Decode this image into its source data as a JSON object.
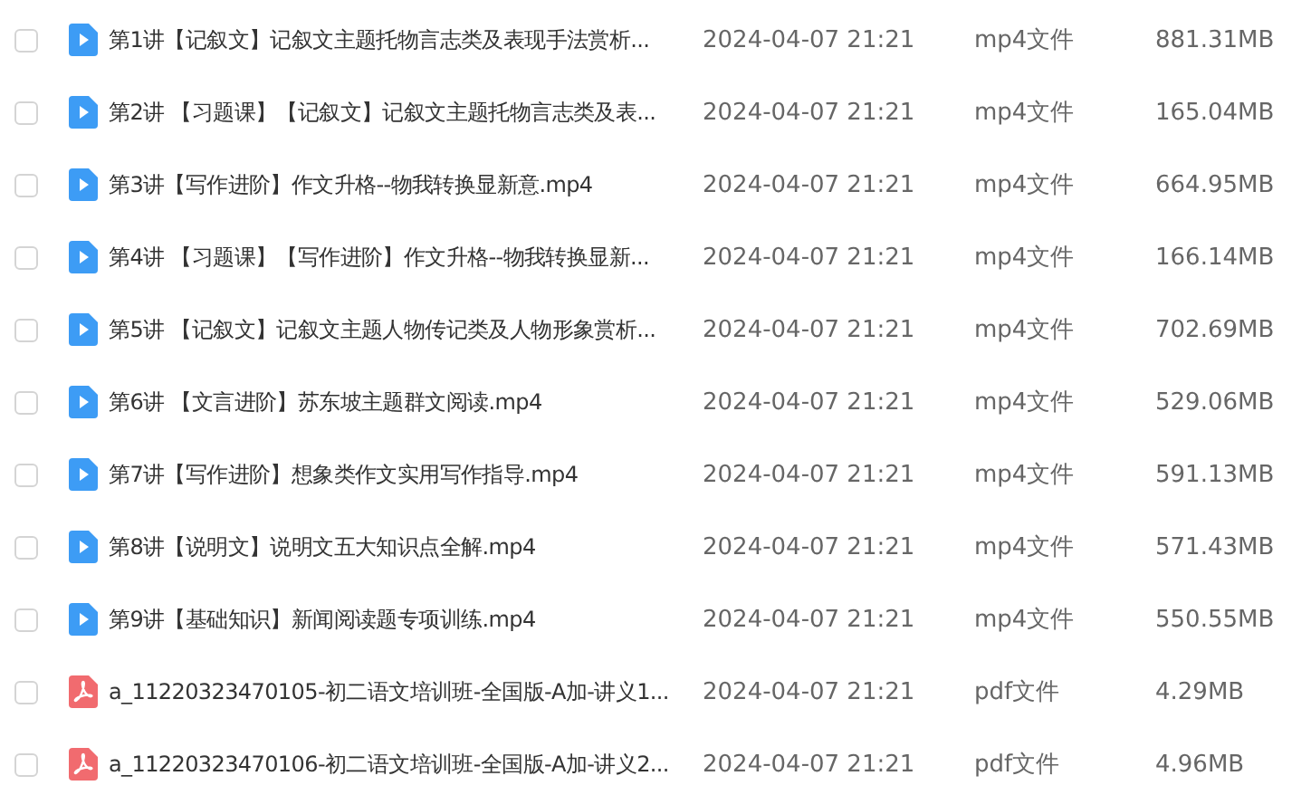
{
  "files": [
    {
      "kind": "video",
      "checked": false,
      "name": "第1讲【记叙文】记叙文主题托物言志类及表现手法赏析...",
      "modified": "2024-04-07 21:21",
      "type": "mp4文件",
      "size": "881.31MB"
    },
    {
      "kind": "video",
      "checked": false,
      "name": "第2讲 【习题课】【记叙文】记叙文主题托物言志类及表...",
      "modified": "2024-04-07 21:21",
      "type": "mp4文件",
      "size": "165.04MB"
    },
    {
      "kind": "video",
      "checked": false,
      "name": "第3讲【写作进阶】作文升格--物我转换显新意.mp4",
      "modified": "2024-04-07 21:21",
      "type": "mp4文件",
      "size": "664.95MB"
    },
    {
      "kind": "video",
      "checked": false,
      "name": "第4讲 【习题课】【写作进阶】作文升格--物我转换显新...",
      "modified": "2024-04-07 21:21",
      "type": "mp4文件",
      "size": "166.14MB"
    },
    {
      "kind": "video",
      "checked": false,
      "name": "第5讲 【记叙文】记叙文主题人物传记类及人物形象赏析...",
      "modified": "2024-04-07 21:21",
      "type": "mp4文件",
      "size": "702.69MB"
    },
    {
      "kind": "video",
      "checked": false,
      "name": "第6讲 【文言进阶】苏东坡主题群文阅读.mp4",
      "modified": "2024-04-07 21:21",
      "type": "mp4文件",
      "size": "529.06MB"
    },
    {
      "kind": "video",
      "checked": false,
      "name": "第7讲【写作进阶】想象类作文实用写作指导.mp4",
      "modified": "2024-04-07 21:21",
      "type": "mp4文件",
      "size": "591.13MB"
    },
    {
      "kind": "video",
      "checked": false,
      "name": "第8讲【说明文】说明文五大知识点全解.mp4",
      "modified": "2024-04-07 21:21",
      "type": "mp4文件",
      "size": "571.43MB"
    },
    {
      "kind": "video",
      "checked": false,
      "name": "第9讲【基础知识】新闻阅读题专项训练.mp4",
      "modified": "2024-04-07 21:21",
      "type": "mp4文件",
      "size": "550.55MB"
    },
    {
      "kind": "pdf",
      "checked": false,
      "name": "a_11220323470105-初二语文培训班-全国版-A加-讲义1...",
      "modified": "2024-04-07 21:21",
      "type": "pdf文件",
      "size": "4.29MB"
    },
    {
      "kind": "pdf",
      "checked": false,
      "name": "a_11220323470106-初二语文培训班-全国版-A加-讲义2...",
      "modified": "2024-04-07 21:21",
      "type": "pdf文件",
      "size": "4.96MB"
    }
  ]
}
